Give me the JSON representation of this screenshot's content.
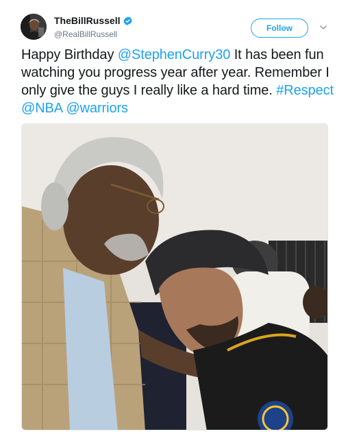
{
  "author": {
    "display_name": "TheBillRussell",
    "handle": "@RealBillRussell",
    "verified_icon": "verified-badge-icon",
    "avatar_icon": "profile-photo"
  },
  "actions": {
    "follow_label": "Follow",
    "more_icon": "chevron-down-icon"
  },
  "tweet": {
    "t1": "Happy Birthday ",
    "mention1": "@StephenCurry30",
    "t2": " It has been fun watching you progress year after year. Remember I only give the guys I really like a hard time. ",
    "hashtag": "#Respect",
    "sp1": " ",
    "mention2": "@NBA",
    "sp2": " ",
    "mention3": "@warriors"
  },
  "media": {
    "kind": "photo"
  },
  "colors": {
    "link": "#1da1f2",
    "text": "#14171a",
    "secondary": "#657786"
  }
}
